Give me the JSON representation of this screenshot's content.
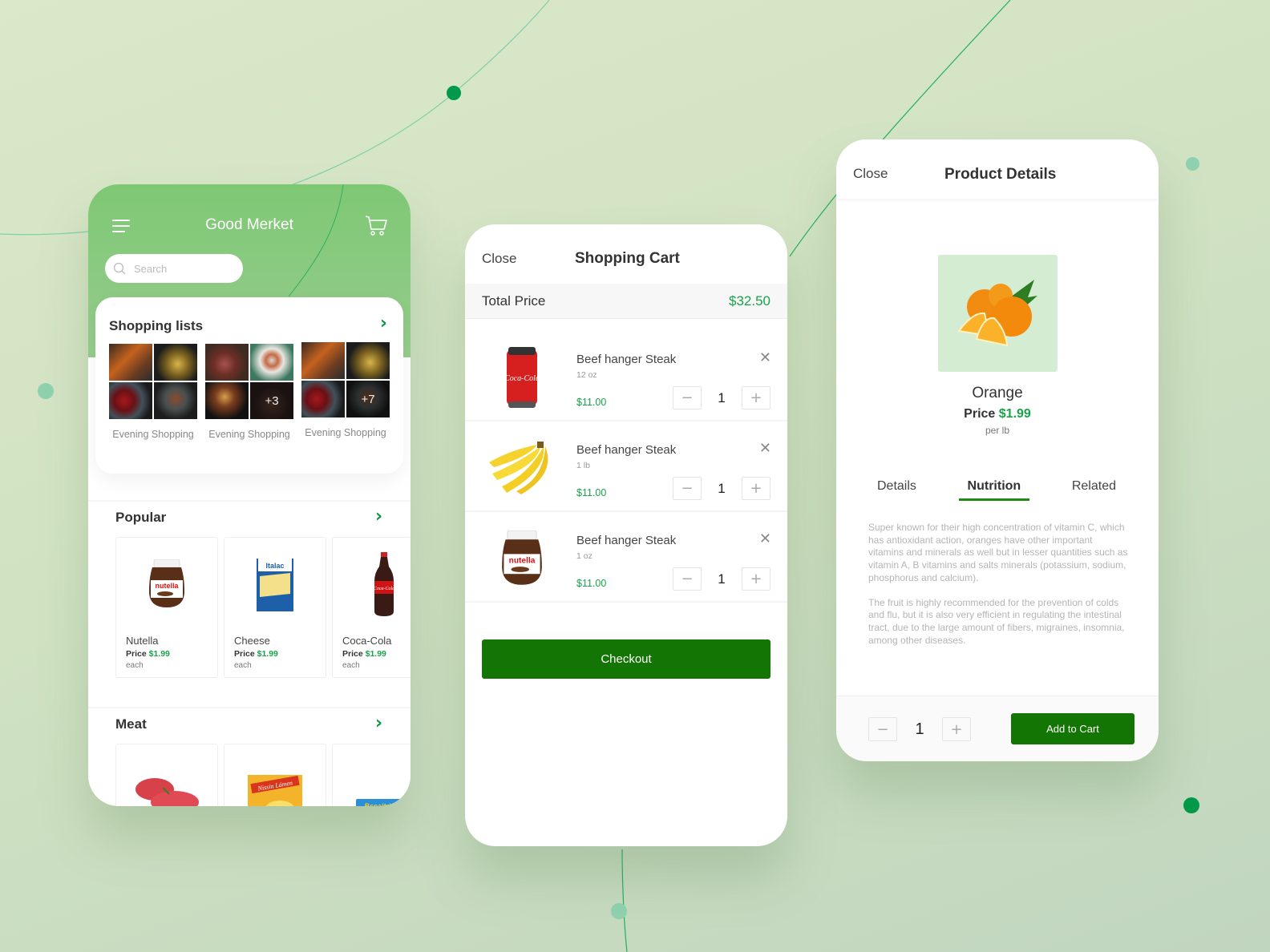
{
  "colors": {
    "brand_green": "#137503",
    "price_green": "#19a34a",
    "header_green": "#7ec874"
  },
  "home": {
    "title": "Good Merket",
    "menu_icon": "hamburger-menu-icon",
    "cart_icon": "shopping-cart-icon",
    "search": {
      "placeholder": "Search",
      "value": "",
      "icon": "search-icon"
    },
    "shopping_lists": {
      "title": "Shopping lists",
      "lists": [
        {
          "label": "Evening Shopping",
          "tiles": [
            "carrots",
            "bananas",
            "apples",
            "apples-bowl"
          ],
          "more": ""
        },
        {
          "label": "Evening Shopping",
          "tiles": [
            "steak",
            "fish-plate",
            "iced-drink",
            "meat"
          ],
          "more": "+3"
        },
        {
          "label": "Evening Shopping",
          "tiles": [
            "carrots",
            "bananas",
            "apples",
            "apples-bowl"
          ],
          "more": "+7"
        }
      ]
    },
    "popular": {
      "title": "Popular",
      "products": [
        {
          "name": "Nutella",
          "price_label": "Price",
          "price": "$1.99",
          "unit": "each",
          "image": "nutella-jar"
        },
        {
          "name": "Cheese",
          "price_label": "Price",
          "price": "$1.99",
          "unit": "each",
          "image": "italac-cheese"
        },
        {
          "name": "Coca-Cola",
          "price_label": "Price",
          "price": "$1.99",
          "unit": "each",
          "image": "coca-cola-bottle"
        }
      ]
    },
    "meat": {
      "title": "Meat",
      "products": [
        {
          "image": "beef-cut"
        },
        {
          "image": "nissin-lamen"
        },
        {
          "image": "biscuit-pack"
        }
      ]
    }
  },
  "cart": {
    "close_label": "Close",
    "title": "Shopping Cart",
    "total_label": "Total Price",
    "total_value": "$32.50",
    "items": [
      {
        "name": "Beef hanger Steak",
        "size": "12 oz",
        "price": "$11.00",
        "qty": "1",
        "image": "coca-cola-can"
      },
      {
        "name": "Beef hanger Steak",
        "size": "1 lb",
        "price": "$11.00",
        "qty": "1",
        "image": "bananas"
      },
      {
        "name": "Beef hanger Steak",
        "size": "1 oz",
        "price": "$11.00",
        "qty": "1",
        "image": "nutella-jar"
      }
    ],
    "minus": "−",
    "plus": "+",
    "remove": "✕",
    "checkout_label": "Checkout"
  },
  "details": {
    "close_label": "Close",
    "title": "Product Details",
    "product": {
      "name": "Orange",
      "price_label": "Price",
      "price": "$1.99",
      "unit": "per lb",
      "image": "oranges"
    },
    "tabs": [
      {
        "label": "Details",
        "active": false
      },
      {
        "label": "Nutrition",
        "active": true
      },
      {
        "label": "Related",
        "active": false
      }
    ],
    "description": [
      "Super known for their high concentration of vitamin C, which has antioxidant action, oranges have other important vitamins and minerals as well but in lesser quantities such as vitamin A, B vitamins and salts minerals (potassium, sodium, phosphorus and calcium).",
      "The fruit is highly recommended for the prevention of colds and flu, but it is also very efficient in regulating the intestinal tract, due to the large amount of fibers, migraines, insomnia, among other diseases."
    ],
    "qty": "1",
    "minus": "−",
    "plus": "+",
    "add_to_cart_label": "Add to Cart"
  }
}
